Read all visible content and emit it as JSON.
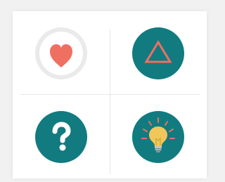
{
  "tiles": [
    {
      "icon": "heart-icon",
      "bg": "#eaeaea",
      "inner": "#ffffff",
      "color": "#ef6f61"
    },
    {
      "icon": "triangle-icon",
      "bg": "#117b80",
      "color": "#ef6f61"
    },
    {
      "icon": "question-mark-icon",
      "bg": "#117b80",
      "color": "#ffffff"
    },
    {
      "icon": "lightbulb-icon",
      "bg": "#117b80",
      "color": "#f3c65a",
      "rays": "#ef6f61"
    }
  ]
}
